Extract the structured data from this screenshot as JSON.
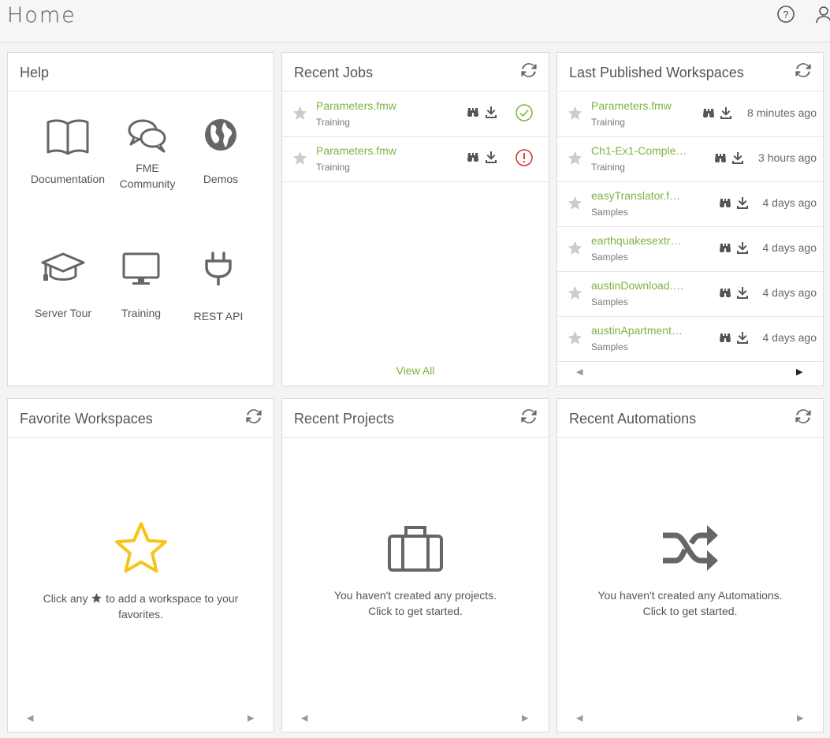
{
  "page": {
    "title": "Home"
  },
  "help": {
    "title": "Help",
    "items": [
      {
        "label": "Documentation"
      },
      {
        "label": "FME\nCommunity"
      },
      {
        "label": "Demos"
      },
      {
        "label": "Server Tour"
      },
      {
        "label": "Training"
      },
      {
        "label": "REST API"
      }
    ]
  },
  "recent_jobs": {
    "title": "Recent Jobs",
    "rows": [
      {
        "name": "Parameters.fmw",
        "sub": "Training",
        "status": "success"
      },
      {
        "name": "Parameters.fmw",
        "sub": "Training",
        "status": "error"
      }
    ],
    "view_all": "View All"
  },
  "last_published": {
    "title": "Last Published Workspaces",
    "rows": [
      {
        "name": "Parameters.fmw",
        "sub": "Training",
        "time": "8 minutes ago"
      },
      {
        "name": "Ch1-Ex1-Comple…",
        "sub": "Training",
        "time": "3 hours ago"
      },
      {
        "name": "easyTranslator.f…",
        "sub": "Samples",
        "time": "4 days ago"
      },
      {
        "name": "earthquakesextr…",
        "sub": "Samples",
        "time": "4 days ago"
      },
      {
        "name": "austinDownload.…",
        "sub": "Samples",
        "time": "4 days ago"
      },
      {
        "name": "austinApartment…",
        "sub": "Samples",
        "time": "4 days ago"
      }
    ]
  },
  "favorites": {
    "title": "Favorite Workspaces",
    "text_before": "Click any",
    "text_after": "to add a workspace to your",
    "text_line2": "favorites."
  },
  "projects": {
    "title": "Recent Projects",
    "line1": "You haven't created any projects.",
    "line2": "Click to get started."
  },
  "automations": {
    "title": "Recent Automations",
    "line1": "You haven't created any Automations.",
    "line2": "Click to get started."
  },
  "colors": {
    "accent": "#7cb342",
    "success": "#7cb342",
    "error": "#d32f2f",
    "star_empty": "#cccccc",
    "star_fav": "#f5c518"
  },
  "icons": [
    "help-icon",
    "user-icon",
    "refresh-icon",
    "star-icon",
    "binoculars-icon",
    "download-icon",
    "check-circle-icon",
    "alert-circle-icon",
    "book-icon",
    "chat-icon",
    "globe-icon",
    "graduation-cap-icon",
    "monitor-icon",
    "plug-icon",
    "briefcase-icon",
    "shuffle-icon"
  ]
}
